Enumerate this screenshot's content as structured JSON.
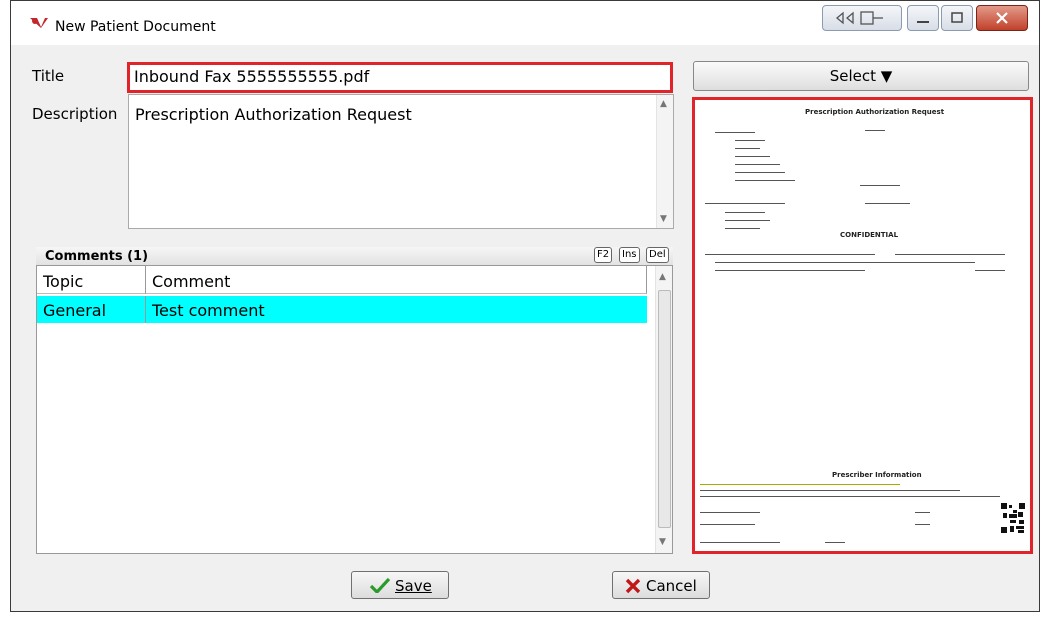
{
  "window": {
    "title": "New Patient Document"
  },
  "form": {
    "title_label": "Title",
    "title_value": "Inbound Fax 5555555555.pdf",
    "description_label": "Description",
    "description_value": "Prescription Authorization Request"
  },
  "comments": {
    "header": "Comments (1)",
    "hotkeys": [
      "F2",
      "Ins",
      "Del"
    ],
    "columns": [
      "Topic",
      "Comment"
    ],
    "rows": [
      {
        "topic": "General",
        "comment": "Test comment"
      }
    ]
  },
  "select_button": {
    "label": "Select ▼"
  },
  "preview_doc": {
    "heading": "Prescription Authorization Request",
    "section_label": "CONFIDENTIAL",
    "footer_heading": "Prescriber Information"
  },
  "buttons": {
    "save": "Save",
    "cancel": "Cancel"
  },
  "colors": {
    "highlight_border": "#e0242a",
    "selected_row": "#00ffff"
  }
}
